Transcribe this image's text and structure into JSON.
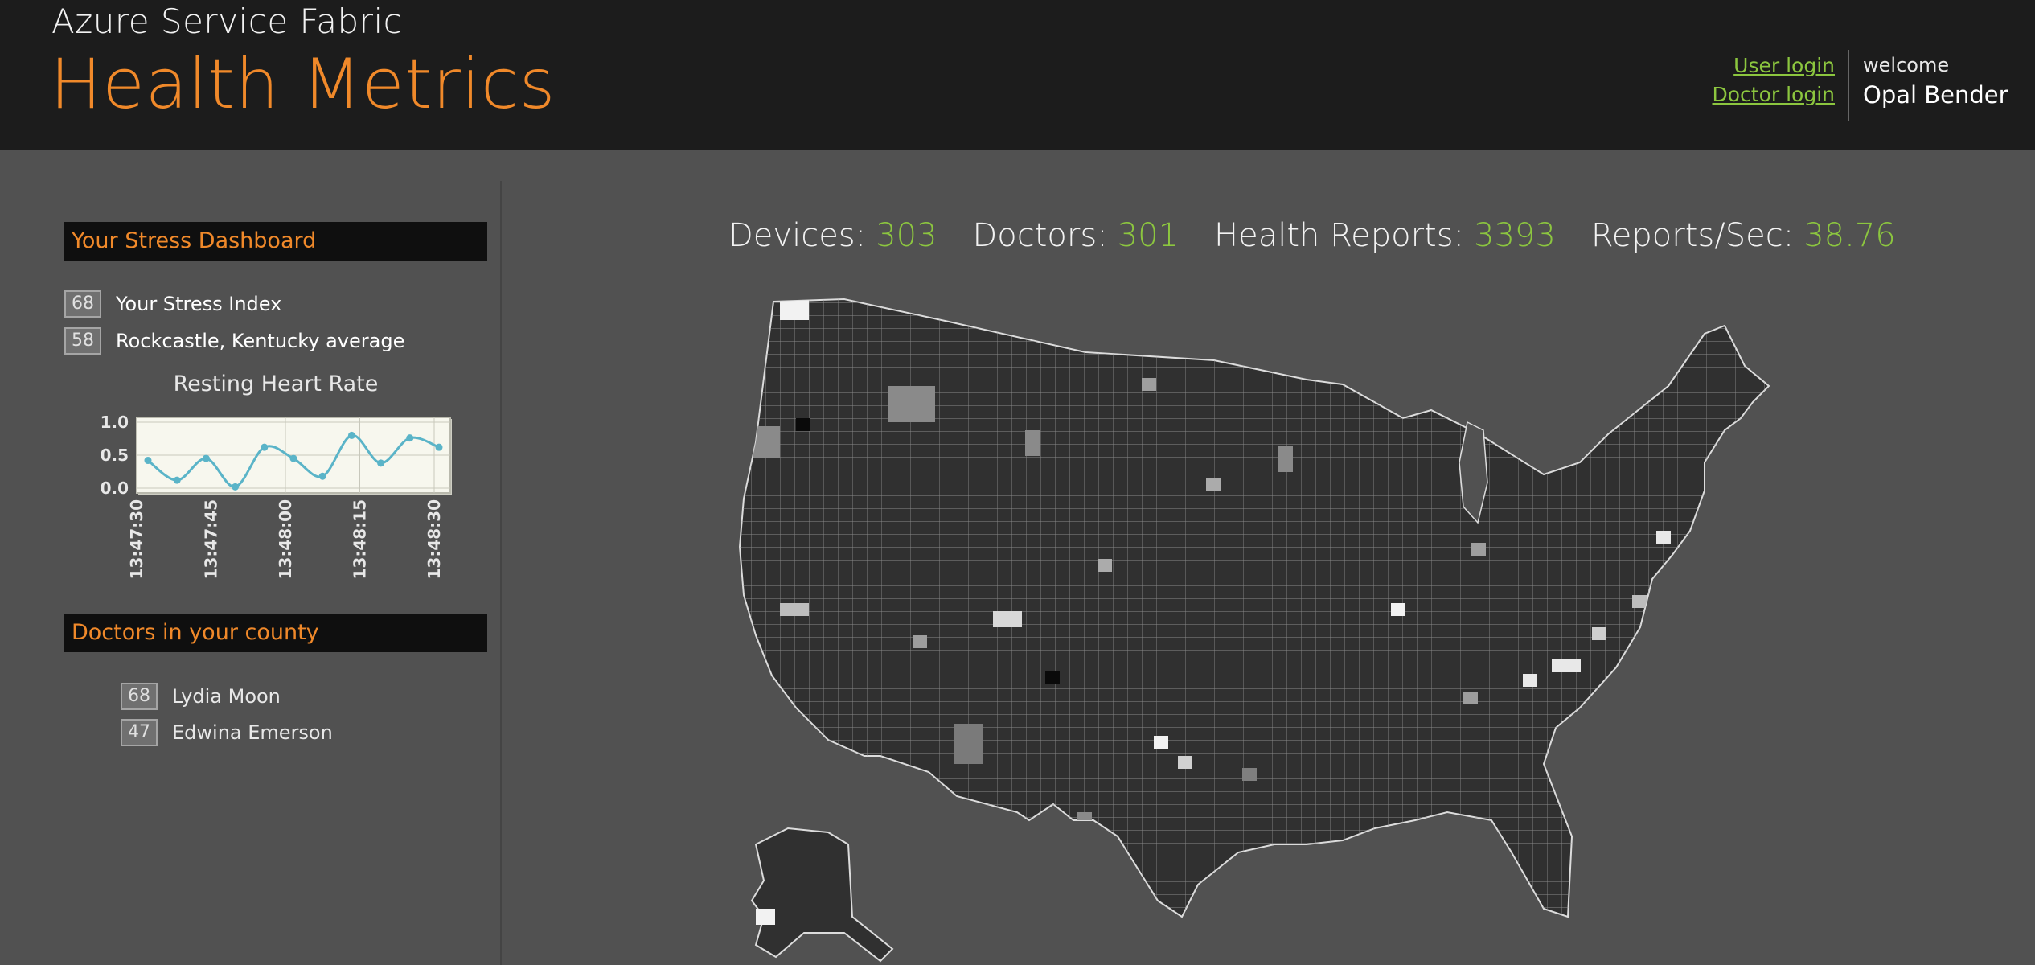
{
  "header": {
    "subtitle": "Azure Service Fabric",
    "title": "Health Metrics",
    "user_login": "User login",
    "doctor_login": "Doctor login",
    "welcome_label": "welcome",
    "user_name": "Opal Bender"
  },
  "stress_dashboard": {
    "title": "Your Stress Dashboard",
    "your_index": {
      "value": "68",
      "label": "Your Stress Index"
    },
    "county_average": {
      "value": "58",
      "label": "Rockcastle, Kentucky average"
    }
  },
  "heart_rate_chart": {
    "title": "Resting Heart Rate",
    "chart_data": {
      "type": "line",
      "title": "Resting Heart Rate",
      "xlabel": "",
      "ylabel": "",
      "ylim": [
        0.0,
        1.0
      ],
      "y_ticks": [
        "0.0",
        "0.5",
        "1.0"
      ],
      "x_ticks": [
        "13:47:30",
        "13:47:45",
        "13:48:00",
        "13:48:15",
        "13:48:30"
      ],
      "x": [
        0,
        1,
        2,
        3,
        4,
        5,
        6,
        7,
        8,
        9,
        10
      ],
      "series": [
        {
          "values": [
            0.42,
            0.12,
            0.45,
            0.02,
            0.62,
            0.45,
            0.18,
            0.8,
            0.38,
            0.76,
            0.62
          ]
        }
      ],
      "grid": true,
      "colors": {
        "line": "#5ab4c8",
        "background": "#f7f7ee"
      }
    }
  },
  "doctors_panel": {
    "title": "Doctors in your county",
    "doctors": [
      {
        "value": "68",
        "name": "Lydia Moon"
      },
      {
        "value": "47",
        "name": "Edwina Emerson"
      }
    ]
  },
  "stats": {
    "devices_label": "Devices:",
    "devices": "303",
    "doctors_label": "Doctors:",
    "doctors": "301",
    "reports_label": "Health Reports:",
    "reports": "3393",
    "rate_label": "Reports/Sec:",
    "rate": "38.76"
  },
  "colors": {
    "accent_orange": "#f0892a",
    "accent_green": "#8cc63f",
    "background": "#515151",
    "header": "#1c1c1c"
  }
}
